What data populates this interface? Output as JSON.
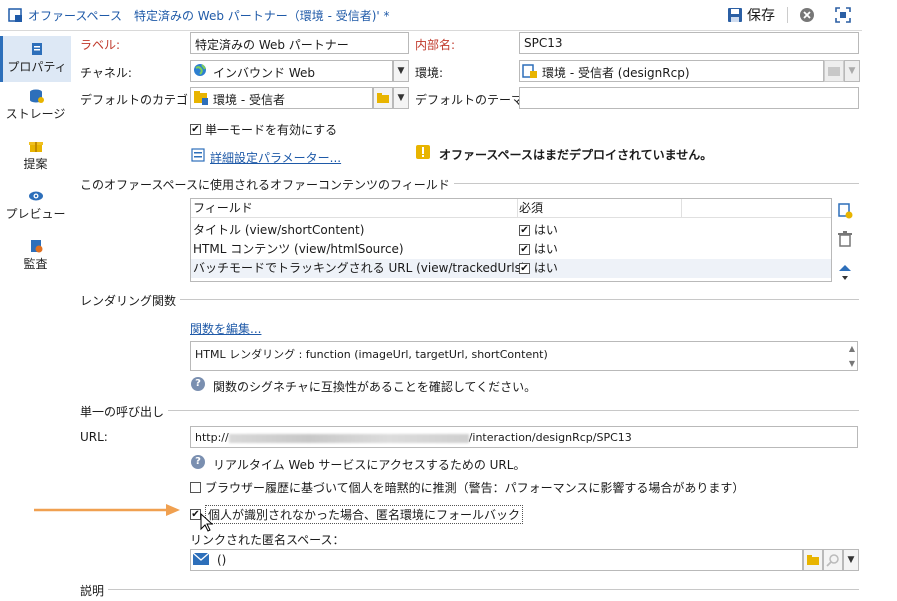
{
  "titlebar": {
    "title": "オファースペース　特定済みの Web パートナー（環境 - 受信者)' *",
    "save_label": "保存"
  },
  "sidebar": {
    "items": [
      {
        "label": "プロパティ"
      },
      {
        "label": "ストレージ"
      },
      {
        "label": "提案"
      },
      {
        "label": "プレビュー"
      },
      {
        "label": "監査"
      }
    ]
  },
  "form": {
    "label_label": "ラベル:",
    "label_value": "特定済みの Web パートナー",
    "internal_name_label": "内部名:",
    "internal_name_value": "SPC13",
    "channel_label": "チャネル:",
    "channel_value": "インバウンド Web",
    "environment_label": "環境:",
    "environment_value": "環境 - 受信者 (designRcp)",
    "default_category_label": "デフォルトのカテゴリ:",
    "default_category_value": "環境 - 受信者",
    "default_theme_label": "デフォルトのテーマ:",
    "default_theme_value": "",
    "single_mode_label": "単一モードを有効にする",
    "single_mode_checked": true,
    "advanced_params_link": "詳細設定パラメーター...",
    "warning_text": "オファースペースはまだデプロイされていません。"
  },
  "fields_section": {
    "title": "このオファースペースに使用されるオファーコンテンツのフィールド",
    "columns": [
      "フィールド",
      "必須"
    ],
    "rows": [
      {
        "field": "タイトル (view/shortContent)",
        "required": "はい"
      },
      {
        "field": "HTML コンテンツ (view/htmlSource)",
        "required": "はい"
      },
      {
        "field": "バッチモードでトラッキングされる URL (view/trackedUrls)",
        "required": "はい"
      }
    ]
  },
  "rendering": {
    "title": "レンダリング関数",
    "edit_link": "関数を編集...",
    "code": "HTML レンダリング : function (imageUrl, targetUrl, shortContent)",
    "hint": "関数のシグネチャに互換性があることを確認してください。"
  },
  "unitary": {
    "title": "単一の呼び出し",
    "url_label": "URL:",
    "url_value_prefix": "http://",
    "url_value_suffix": "/interaction/designRcp/SPC13",
    "url_hint": "リアルタイム Web サービスにアクセスするための URL。",
    "browser_history_label": "ブラウザー履歴に基づいて個人を暗黙的に推測（警告：パフォーマンスに影響する場合があります）",
    "fallback_label": "個人が識別されなかった場合、匿名環境にフォールバック",
    "linked_space_label": "リンクされた匿名スペース：",
    "linked_space_value": "()"
  },
  "description": {
    "title": "説明"
  },
  "colors": {
    "accent": "#1f5aa8",
    "arrow": "#f0a050",
    "warning": "#e8b400"
  }
}
